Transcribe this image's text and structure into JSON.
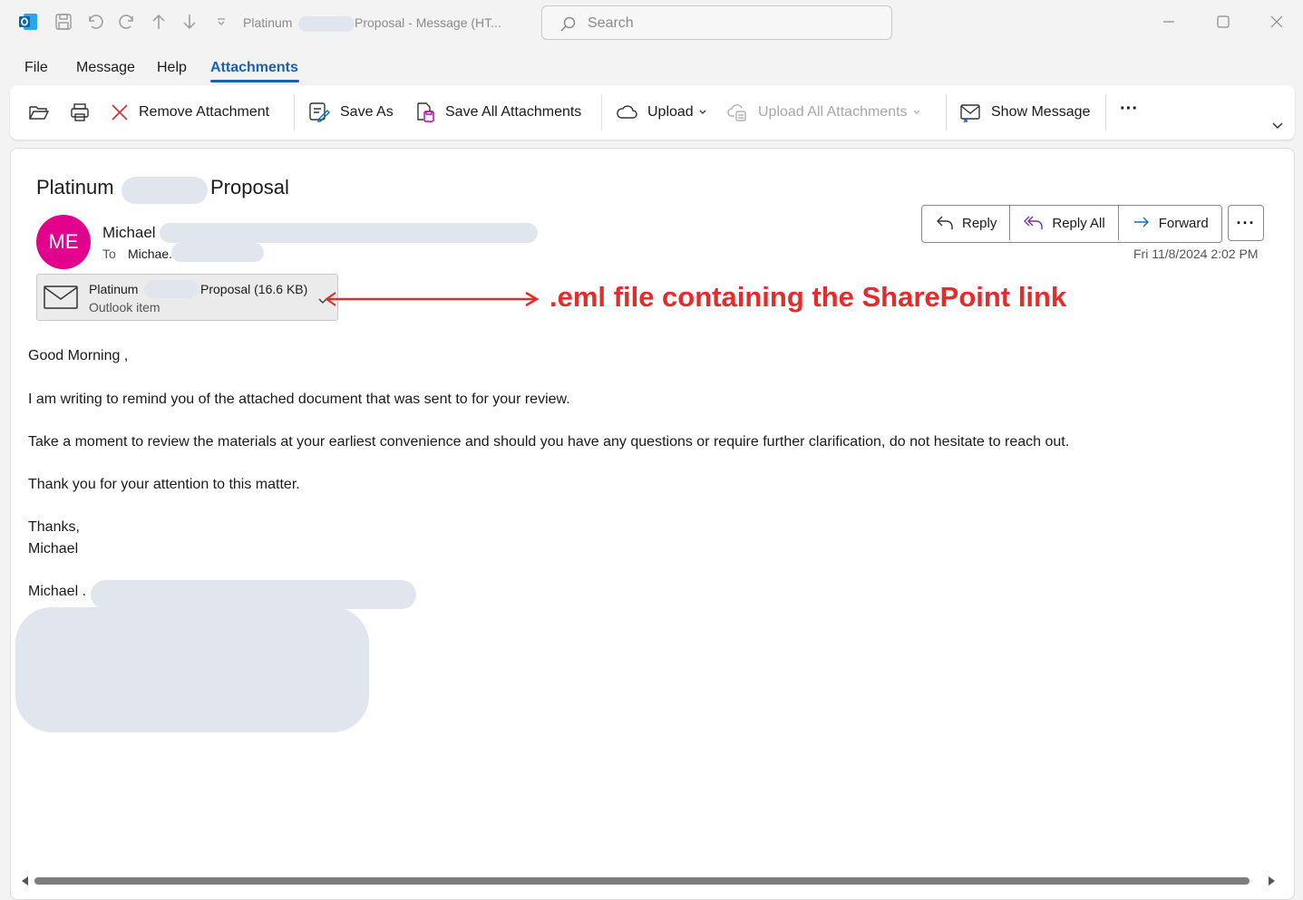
{
  "window": {
    "title_prefix": "Platinum",
    "title_suffix": "Proposal  -  Message (HT...",
    "search_placeholder": "Search"
  },
  "menu": {
    "tabs": [
      "File",
      "Message",
      "Help",
      "Attachments"
    ],
    "active_tab": "Attachments"
  },
  "ribbon": {
    "remove_attachment": "Remove Attachment",
    "save_as": "Save As",
    "save_all": "Save All Attachments",
    "upload": "Upload",
    "upload_all": "Upload All Attachments",
    "show_message": "Show Message",
    "more": "···"
  },
  "message": {
    "subject_prefix": "Platinum",
    "subject_suffix": "Proposal",
    "avatar_initials": "ME",
    "avatar_color": "#e3008c",
    "sender": "Michael",
    "to_label": "To",
    "to_name": "Michae.",
    "date": "Fri 11/8/2024 2:02 PM",
    "actions": {
      "reply": "Reply",
      "reply_all": "Reply All",
      "forward": "Forward",
      "more": "···"
    }
  },
  "attachment": {
    "name_prefix": "Platinum",
    "name_suffix": "Proposal (16.6 KB)",
    "type": "Outlook item"
  },
  "annotation": {
    "text": ".eml file containing the SharePoint link",
    "color": "#e52b2b"
  },
  "body": {
    "greeting": "Good Morning ,",
    "p1": "I am writing to remind you of the attached document that was sent to for your review.",
    "p2": "Take a moment to review the materials at your earliest convenience and should you have any questions or require further clarification, do not hesitate to reach out.",
    "p3": "Thank you for your attention to this matter.",
    "closing": "Thanks,",
    "signoff_name": "Michael",
    "signature_name": "Michael ."
  }
}
